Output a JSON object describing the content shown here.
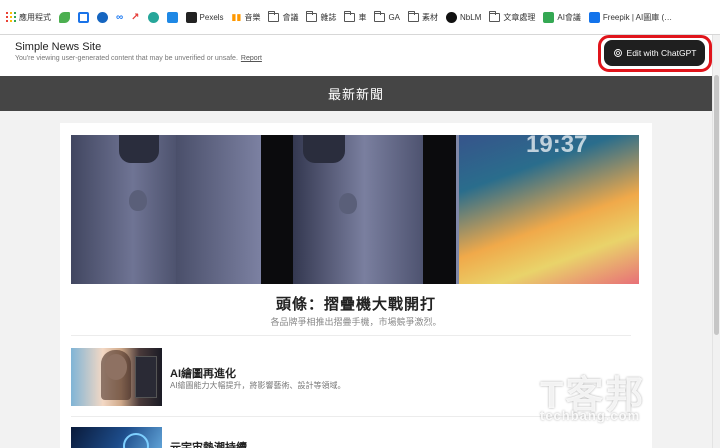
{
  "bookmarks": [
    {
      "label": "應用程式",
      "icon": "apps-grid-icon"
    },
    {
      "label": "",
      "icon": "green-leaf-icon",
      "color": "#4caf50"
    },
    {
      "label": "",
      "icon": "blue-square-icon",
      "color": "#1a73e8"
    },
    {
      "label": "",
      "icon": "c-logo-icon",
      "color": "#1565c0"
    },
    {
      "label": "",
      "icon": "meta-infinity-icon",
      "color": "#1877f2"
    },
    {
      "label": "",
      "icon": "trend-arrow-icon",
      "color": "#e53935"
    },
    {
      "label": "",
      "icon": "teal-s-icon",
      "color": "#26a69a"
    },
    {
      "label": "",
      "icon": "blue-app-icon",
      "color": "#1e88e5"
    },
    {
      "label": "Pexels",
      "icon": "pexels-icon",
      "color": "#222222"
    },
    {
      "label": "音樂",
      "icon": "music-bars-icon",
      "color": "#ff9800"
    },
    {
      "label": "會議",
      "icon": "folder-icon"
    },
    {
      "label": "雜誌",
      "icon": "folder-icon"
    },
    {
      "label": "車",
      "icon": "folder-icon"
    },
    {
      "label": "GA",
      "icon": "folder-icon"
    },
    {
      "label": "素材",
      "icon": "folder-icon"
    },
    {
      "label": "NbLM",
      "icon": "notebooklm-icon",
      "color": "#111111"
    },
    {
      "label": "文章處理",
      "icon": "folder-icon"
    },
    {
      "label": "AI會議",
      "icon": "green-sheet-icon",
      "color": "#34a853"
    },
    {
      "label": "Freepik | AI圖庫 (…",
      "icon": "freepik-icon",
      "color": "#1273eb"
    }
  ],
  "header": {
    "site_title": "Simple News Site",
    "notice": "You're viewing user-generated content that may be unverified or unsafe.",
    "report_link": "Report",
    "edit_button": "Edit with ChatGPT"
  },
  "nav": {
    "title": "最新新聞"
  },
  "headline": {
    "title": "頭條：摺疊機大戰開打",
    "subtitle": "各品牌爭相推出摺疊手機，市場競爭激烈。"
  },
  "articles": [
    {
      "title": "AI繪圖再進化",
      "desc": "AI繪圖能力大幅提升，將影響藝術、設計等領域。"
    },
    {
      "title": "元宇宙熱潮持續",
      "desc": ""
    }
  ],
  "watermark": {
    "logo": "T客邦",
    "url": "techbang.com"
  },
  "colors": {
    "accent_ring": "#e0141b",
    "nav_bg": "#454545",
    "button_bg": "#1f1f1f"
  }
}
